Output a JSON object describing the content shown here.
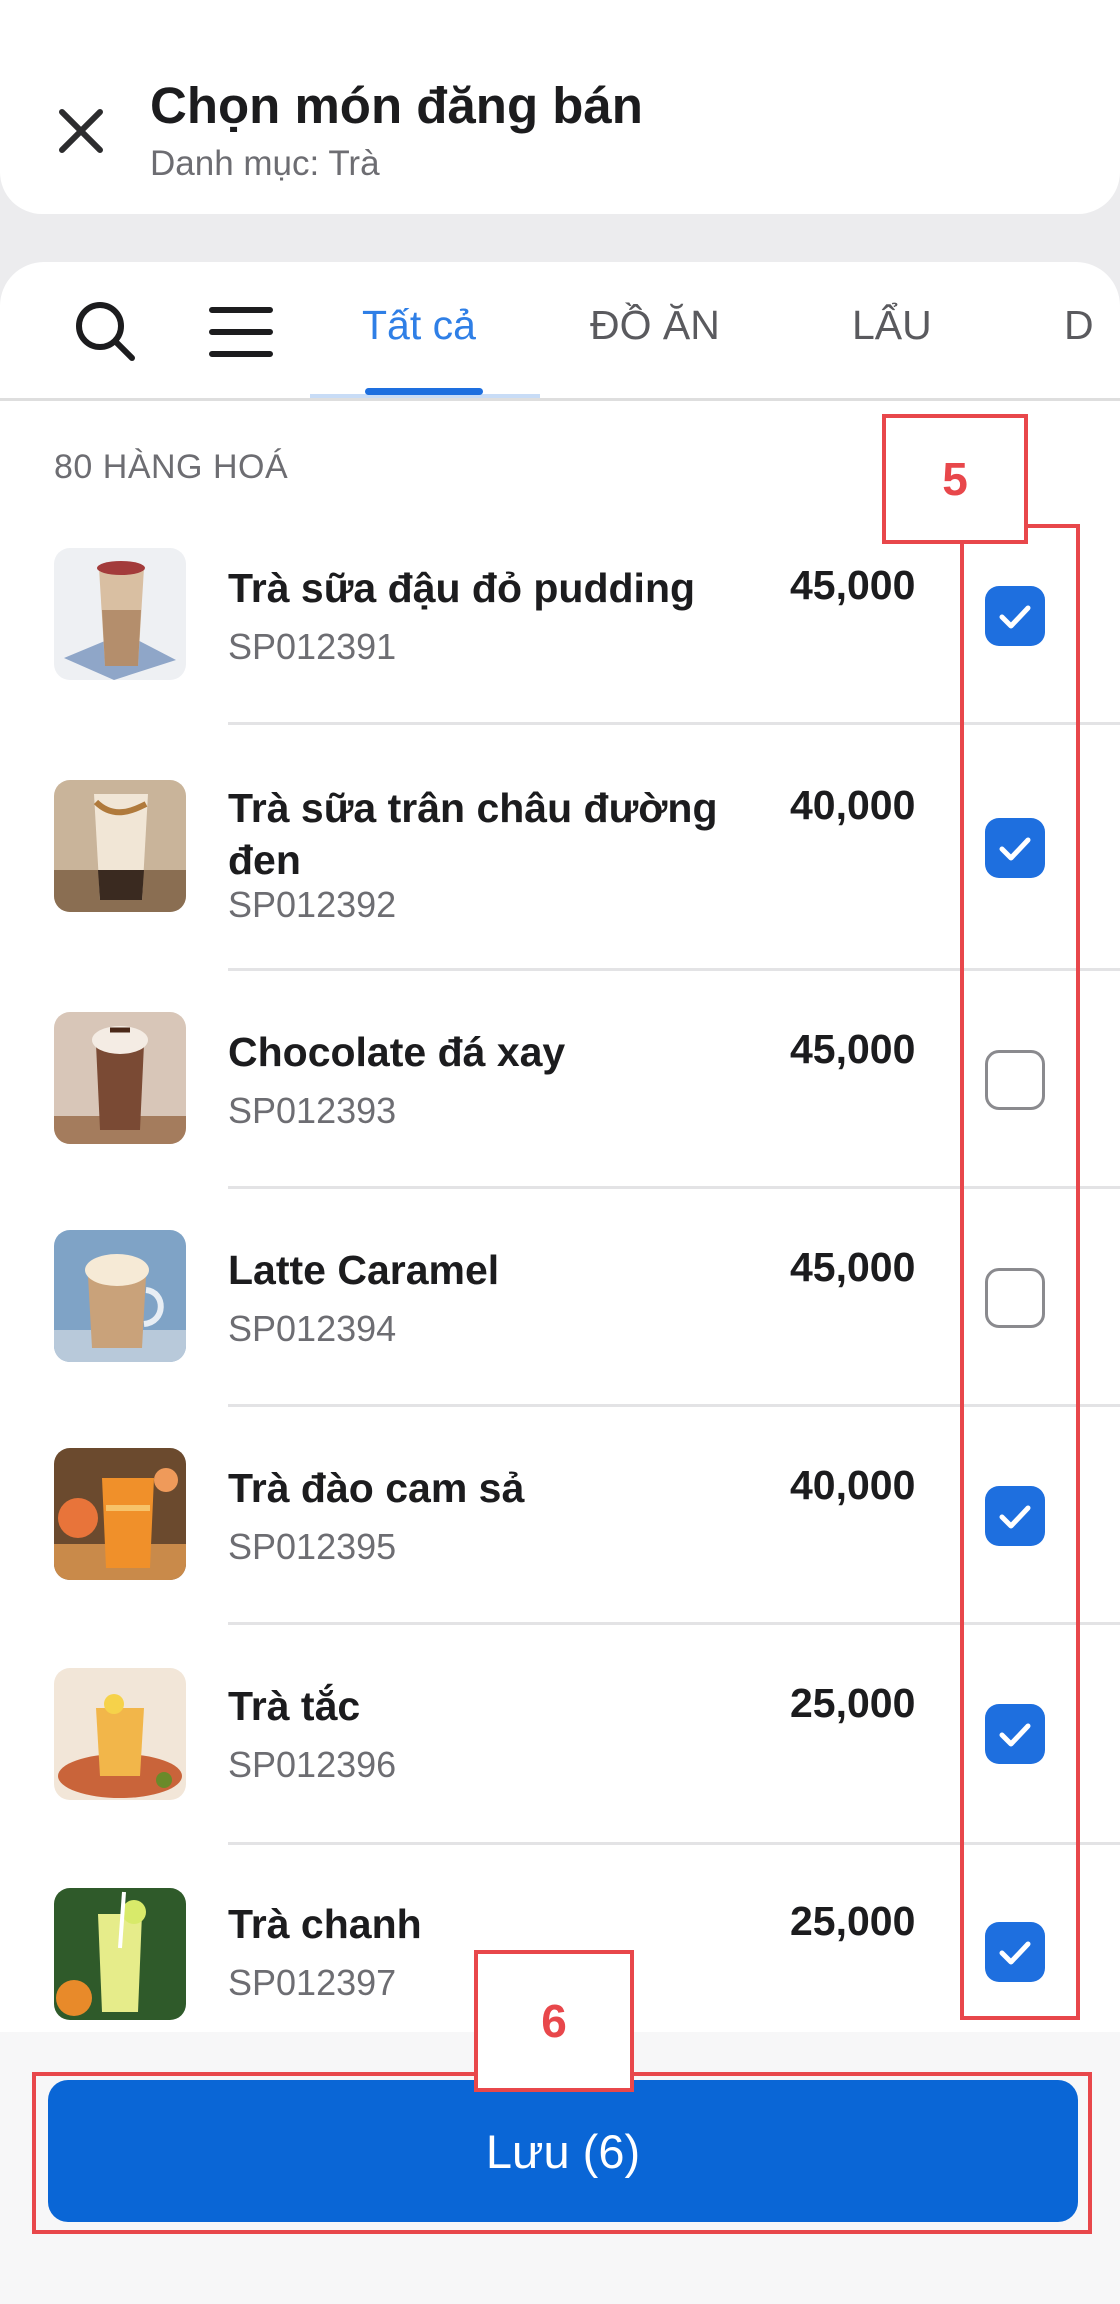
{
  "header": {
    "title": "Chọn món đăng bán",
    "subtitle": "Danh mục: Trà"
  },
  "tabs": [
    {
      "label": "Tất cả",
      "active": true
    },
    {
      "label": "ĐỒ ĂN",
      "active": false
    },
    {
      "label": "LẨU",
      "active": false
    },
    {
      "label": "D",
      "active": false
    }
  ],
  "list": {
    "count_label": "80 HÀNG HOÁ",
    "items": [
      {
        "name": "Trà sữa đậu đỏ pudding",
        "code": "SP012391",
        "price": "45,000",
        "checked": true
      },
      {
        "name": "Trà sữa trân châu đường đen",
        "code": "SP012392",
        "price": "40,000",
        "checked": true
      },
      {
        "name": "Chocolate đá xay",
        "code": "SP012393",
        "price": "45,000",
        "checked": false
      },
      {
        "name": "Latte Caramel",
        "code": "SP012394",
        "price": "45,000",
        "checked": false
      },
      {
        "name": "Trà đào cam sả",
        "code": "SP012395",
        "price": "40,000",
        "checked": true
      },
      {
        "name": "Trà tắc",
        "code": "SP012396",
        "price": "25,000",
        "checked": true
      },
      {
        "name": "Trà chanh",
        "code": "SP012397",
        "price": "25,000",
        "checked": true
      }
    ]
  },
  "footer": {
    "save_label": "Lưu (6)"
  },
  "annotations": [
    {
      "label": "5"
    },
    {
      "label": "6"
    }
  ],
  "colors": {
    "accent": "#1e6fdf",
    "save_button": "#0a66d6",
    "annotation": "#e8474b"
  },
  "icons": {
    "close": "close-icon",
    "search": "search-icon",
    "menu": "menu-icon",
    "check": "check-icon"
  }
}
